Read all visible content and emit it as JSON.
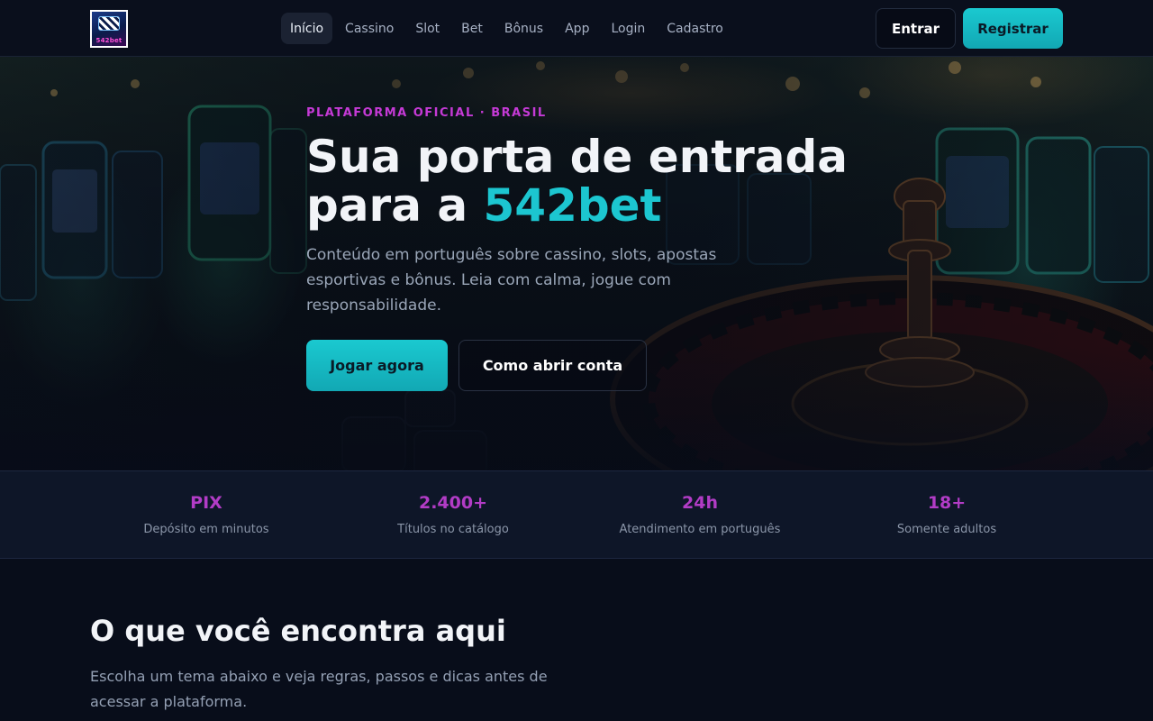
{
  "header": {
    "logo_text": "542bet",
    "nav": [
      {
        "label": "Início",
        "active": true
      },
      {
        "label": "Cassino",
        "active": false
      },
      {
        "label": "Slot",
        "active": false
      },
      {
        "label": "Bet",
        "active": false
      },
      {
        "label": "Bônus",
        "active": false
      },
      {
        "label": "App",
        "active": false
      },
      {
        "label": "Login",
        "active": false
      },
      {
        "label": "Cadastro",
        "active": false
      }
    ],
    "login_label": "Entrar",
    "register_label": "Registrar"
  },
  "hero": {
    "eyebrow": "PLATAFORMA OFICIAL · BRASIL",
    "title_line1": "Sua porta de entrada",
    "title_line2_prefix": "para a ",
    "title_accent": "542bet",
    "subtitle": "Conteúdo em português sobre cassino, slots, apostas esportivas e bônus. Leia com calma, jogue com responsabilidade.",
    "primary_cta": "Jogar agora",
    "secondary_cta": "Como abrir conta"
  },
  "stats": [
    {
      "value": "PIX",
      "label": "Depósito em minutos"
    },
    {
      "value": "2.400+",
      "label": "Títulos no catálogo"
    },
    {
      "value": "24h",
      "label": "Atendimento em português"
    },
    {
      "value": "18+",
      "label": "Somente adultos"
    }
  ],
  "section": {
    "title": "O que você encontra aqui",
    "subtitle": "Escolha um tema abaixo e veja regras, passos e dicas antes de acessar a plataforma."
  },
  "colors": {
    "accent": "#1cc6d0",
    "highlight": "#b23cc6",
    "background": "#080d1a"
  }
}
